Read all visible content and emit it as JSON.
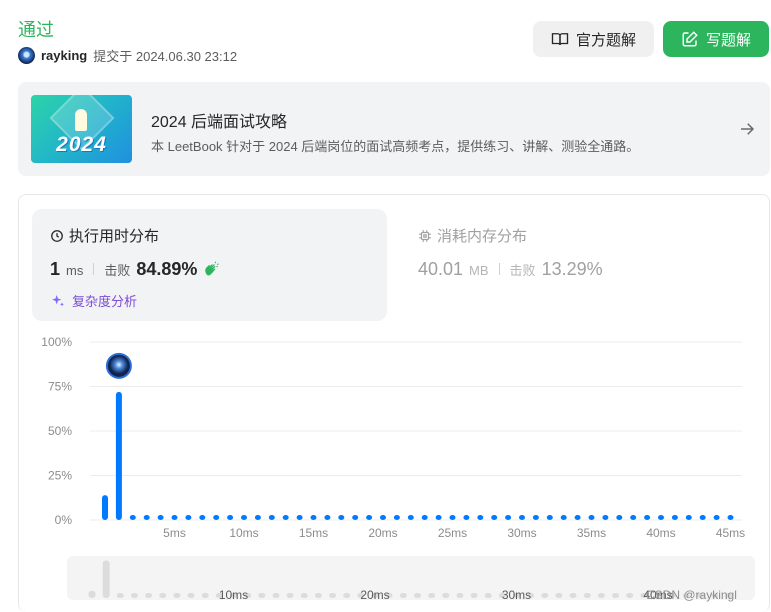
{
  "submission": {
    "status": "通过",
    "user": "rayking",
    "submitted_label": "提交于 2024.06.30 23:12"
  },
  "actions": {
    "official_solution": "官方题解",
    "write_solution": "写题解"
  },
  "banner": {
    "year_badge": "2024",
    "title": "2024 后端面试攻略",
    "description": "本 LeetBook 针对于 2024 后端岗位的面试高频考点，提供练习、讲解、测验全通路。"
  },
  "runtime": {
    "title": "执行用时分布",
    "value": "1",
    "unit": "ms",
    "beat_label": "击败",
    "beat": "84.89%",
    "complexity_link": "复杂度分析"
  },
  "memory": {
    "title": "消耗内存分布",
    "value": "40.01",
    "unit": "MB",
    "beat_label": "击败",
    "beat": "13.29%"
  },
  "colors": {
    "accent_green": "#2db55d",
    "bar_blue": "#007aff",
    "complexity_purple": "#7b4cd8"
  },
  "chart_data": {
    "type": "bar",
    "x": [
      0,
      1,
      2,
      3,
      4,
      5,
      6,
      7,
      8,
      9,
      10,
      11,
      12,
      13,
      14,
      15,
      16,
      17,
      18,
      19,
      20,
      21,
      22,
      23,
      24,
      25,
      26,
      27,
      28,
      29,
      30,
      31,
      32,
      33,
      34,
      35,
      36,
      37,
      38,
      39,
      40,
      41,
      42,
      43,
      44,
      45
    ],
    "values": [
      14,
      72,
      0,
      0,
      0,
      0,
      0,
      0,
      0,
      0,
      0,
      0,
      0,
      0,
      0,
      0,
      0,
      0,
      0,
      0,
      0,
      0,
      0,
      0,
      0,
      0,
      0,
      0,
      0,
      0,
      0,
      0,
      0,
      0,
      0,
      0,
      0,
      0,
      0,
      0,
      0,
      0,
      0,
      0,
      0,
      0
    ],
    "highlight_x": 1,
    "x_unit": "ms",
    "ylim": [
      0,
      100
    ],
    "y_ticks": [
      "0%",
      "25%",
      "50%",
      "75%",
      "100%"
    ],
    "x_ticks": [
      "5ms",
      "10ms",
      "15ms",
      "20ms",
      "25ms",
      "30ms",
      "35ms",
      "40ms",
      "45ms"
    ],
    "x_tick_values": [
      5,
      10,
      15,
      20,
      25,
      30,
      35,
      40,
      45
    ],
    "grid": true,
    "overview_ticks": [
      "10ms",
      "20ms",
      "30ms",
      "40ms"
    ],
    "overview_tick_values": [
      10,
      20,
      30,
      40
    ]
  },
  "watermark": "CSDN @raykingl"
}
